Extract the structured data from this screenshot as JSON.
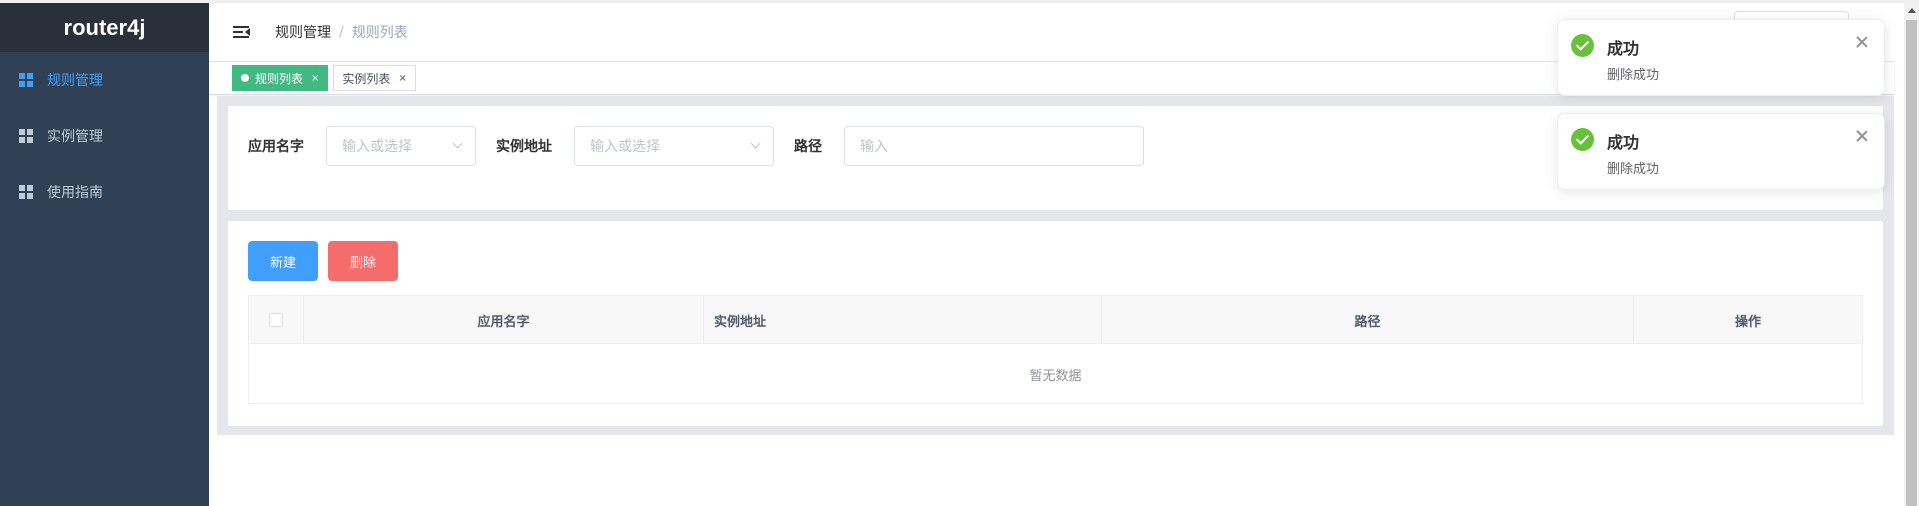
{
  "app": {
    "title": "router4j"
  },
  "sidebar": {
    "items": [
      {
        "label": "规则管理",
        "icon": "grid-icon",
        "active": true
      },
      {
        "label": "实例管理",
        "icon": "grid-icon",
        "active": false
      },
      {
        "label": "使用指南",
        "icon": "grid-icon",
        "active": false
      }
    ]
  },
  "header": {
    "breadcrumb": [
      "规则管理",
      "规则列表"
    ],
    "separator": "/"
  },
  "tags": [
    {
      "label": "规则列表",
      "active": true,
      "close": "×"
    },
    {
      "label": "实例列表",
      "active": false,
      "close": "×"
    }
  ],
  "filter": {
    "app_name_label": "应用名字",
    "app_name_placeholder": "输入或选择",
    "instance_label": "实例地址",
    "instance_placeholder": "输入或选择",
    "path_label": "路径",
    "path_placeholder": "输入"
  },
  "toolbar": {
    "new_label": "新建",
    "delete_label": "删除"
  },
  "table": {
    "columns": [
      "应用名字",
      "实例地址",
      "路径",
      "操作"
    ],
    "empty_text": "暂无数据"
  },
  "notifications": [
    {
      "title": "成功",
      "message": "删除成功",
      "icon": "success-check-icon"
    },
    {
      "title": "成功",
      "message": "删除成功",
      "icon": "success-check-icon"
    }
  ],
  "colors": {
    "sidebar_bg": "#304156",
    "active_text": "#409eff",
    "tag_active": "#42b983",
    "primary": "#409eff",
    "danger": "#f56c6c",
    "success": "#67c23a"
  }
}
